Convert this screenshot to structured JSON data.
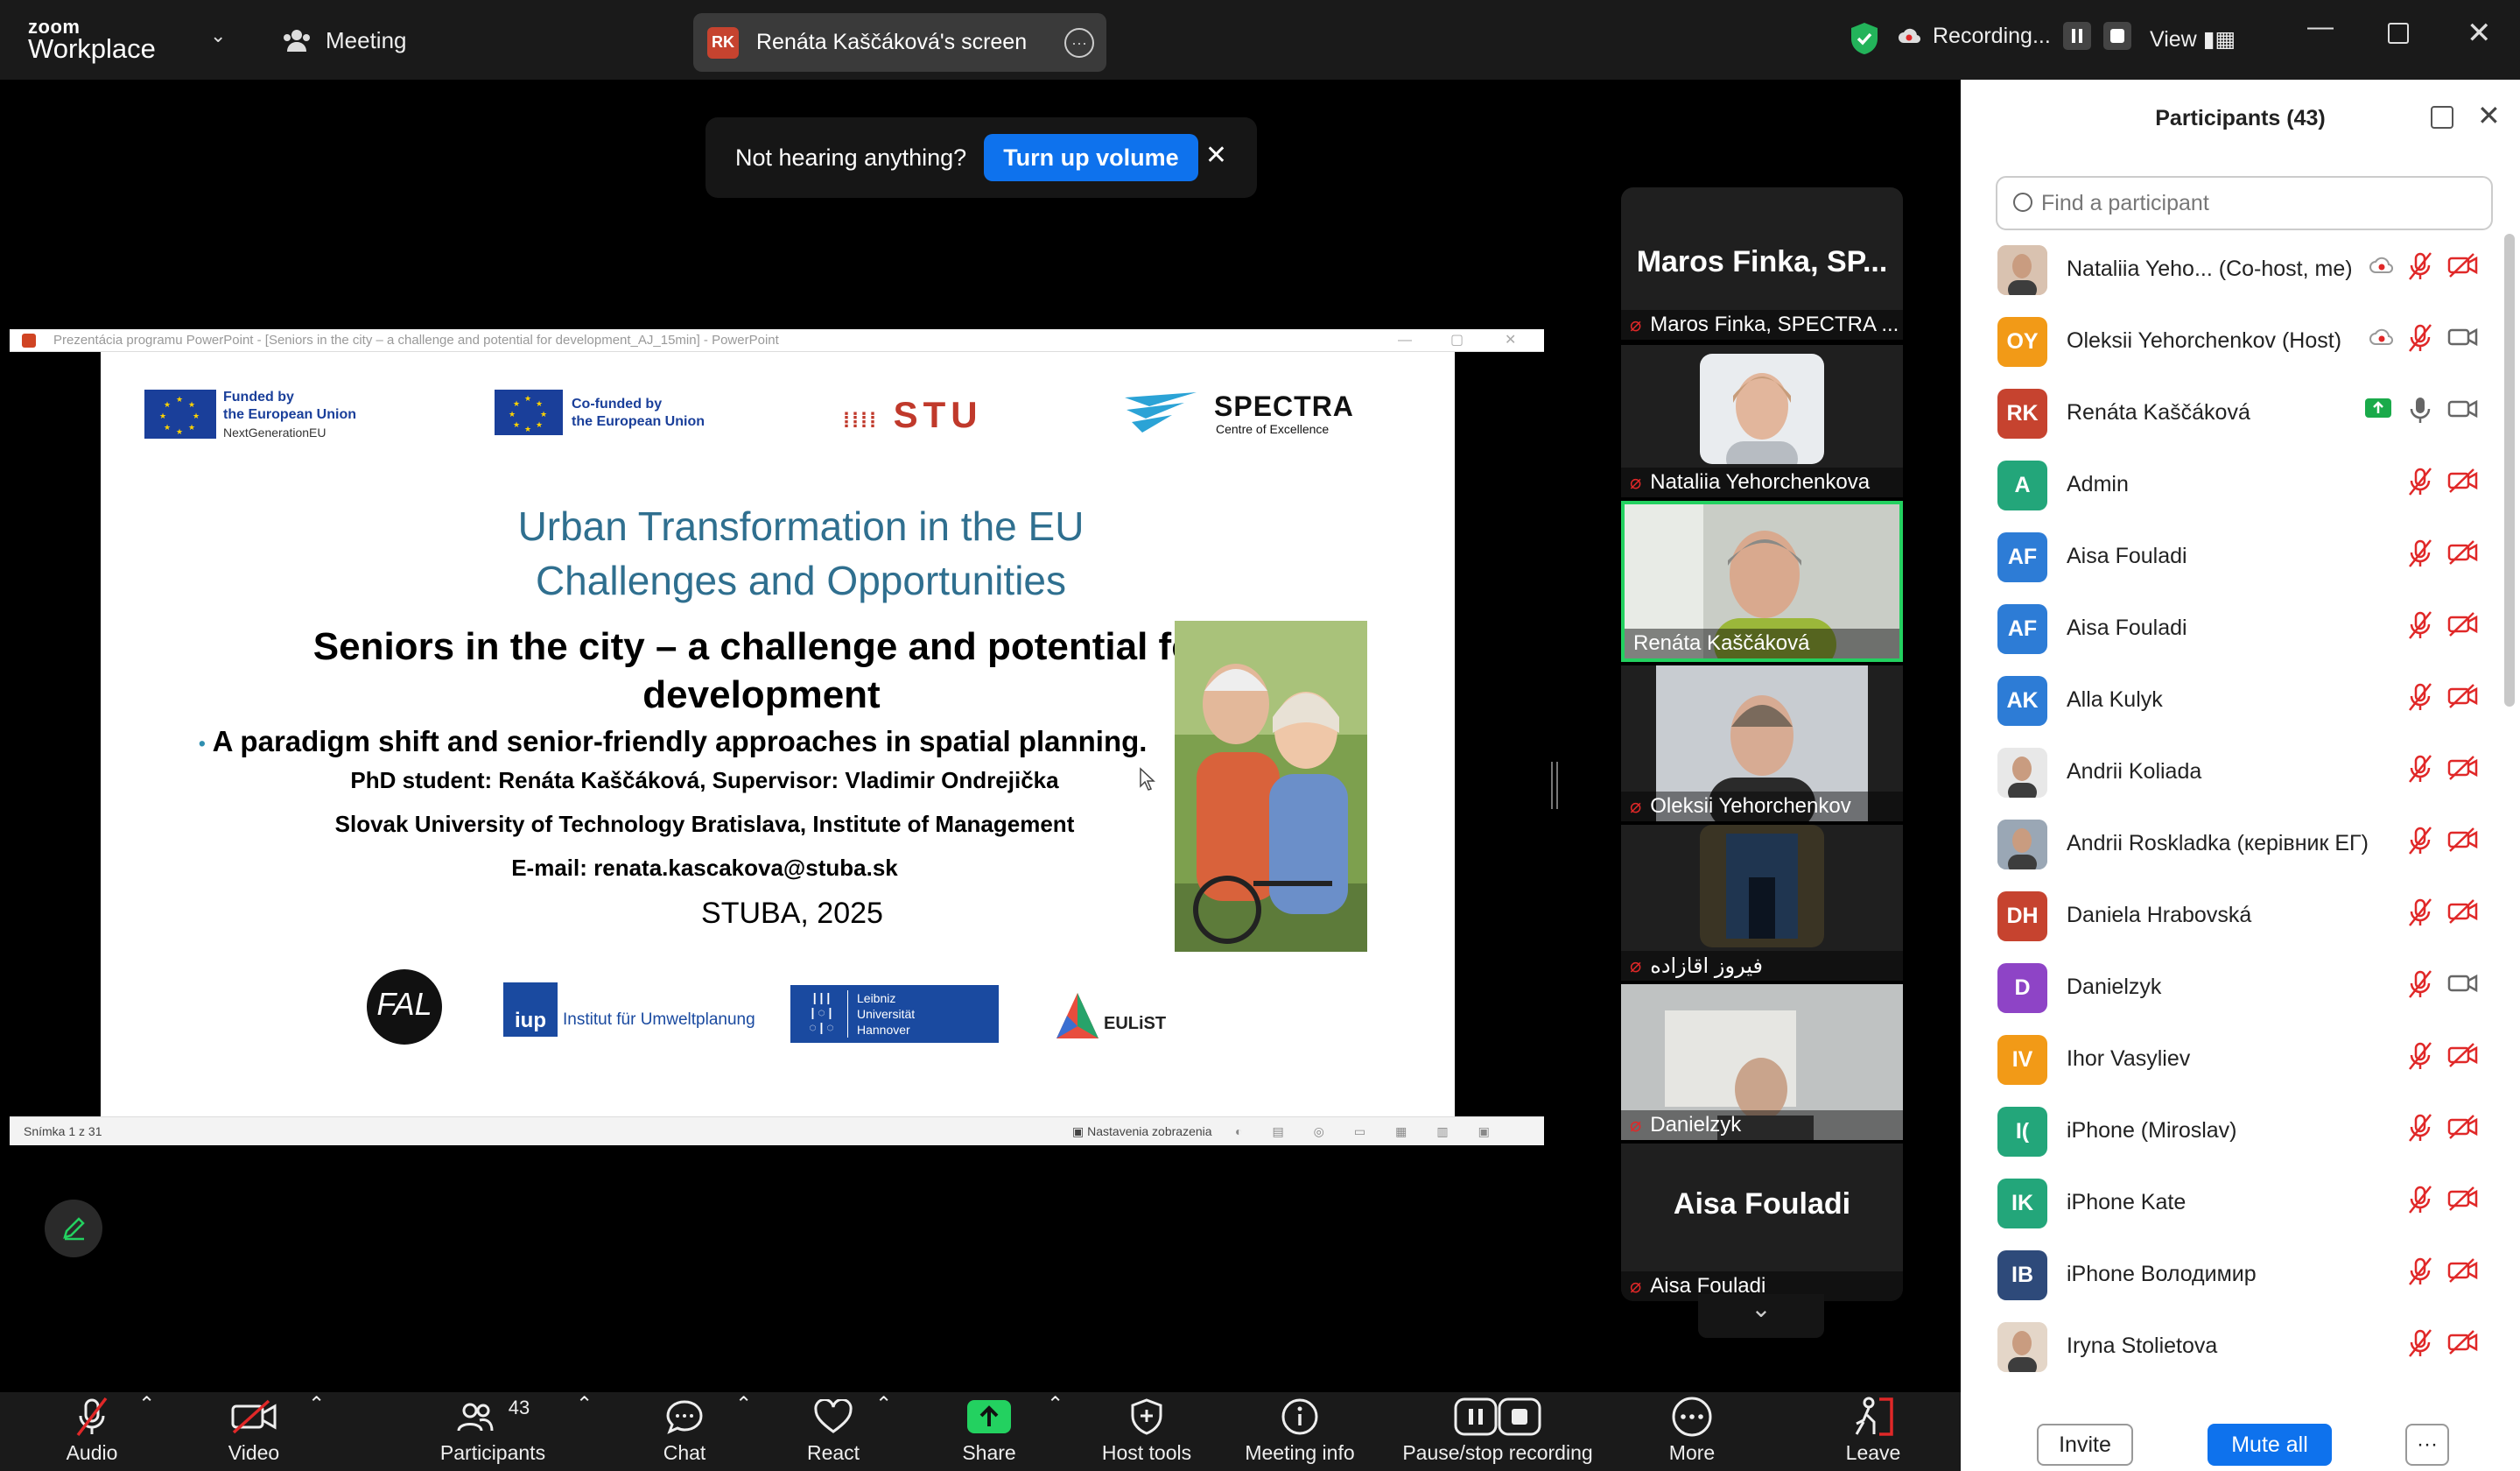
{
  "app": {
    "brand_top": "zoom",
    "brand_bottom": "Workplace",
    "meeting_label": "Meeting"
  },
  "screen_share": {
    "badge": "RK",
    "label": "Renáta Kaščáková's screen"
  },
  "recording": {
    "label": "Recording..."
  },
  "view": {
    "label": "View"
  },
  "notice": {
    "message": "Not hearing anything?",
    "button": "Turn up volume"
  },
  "ppt": {
    "window_title": "Prezentácia programu PowerPoint - [Seniors in the city – a challenge and potential for development_AJ_15min] - PowerPoint",
    "status_left": "Snímka 1 z 31",
    "status_view": "Nastavenia zobrazenia"
  },
  "slide": {
    "logo_eu1_line1": "Funded by",
    "logo_eu1_line2": "the European Union",
    "logo_eu1_line3": "NextGenerationEU",
    "logo_eu2_line1": "Co-funded by",
    "logo_eu2_line2": "the European Union",
    "logo_stu": "STU",
    "logo_spectra": "SPECTRA",
    "logo_spectra_sub": "Centre of Excellence",
    "heading1": "Urban Transformation in the EU",
    "heading2": "Challenges and Opportunities",
    "title_line1": "Seniors in the city – a challenge and potential for",
    "title_line2": "development",
    "subtitle": "A paradigm shift and senior-friendly approaches in spatial planning.",
    "phd_line": "PhD student:  Renáta Kaščáková, Supervisor: Vladimir Ondrejička",
    "university": "Slovak University of Technology Bratislava, Institute of Management",
    "email": "E-mail:  renata.kascakova@stuba.sk",
    "footer": "STUBA, 2025",
    "logo_fal": "FAL",
    "logo_iup": "iup",
    "logo_iup_text": "Institut für Umweltplanung",
    "logo_luh_line1": "Leibniz",
    "logo_luh_line2": "Universität",
    "logo_luh_line3": "Hannover",
    "logo_eulist": "EULiST"
  },
  "gallery": {
    "tiles": [
      {
        "big": "Maros Finka, SP...",
        "name": "Maros Finka, SPECTRA ..."
      },
      {
        "name": "Nataliia Yehorchenkova"
      },
      {
        "name": "Renáta Kaščáková"
      },
      {
        "name": "Oleksii Yehorchenkov"
      },
      {
        "name": "فیروز اقازاده"
      },
      {
        "name": "Danielzyk"
      },
      {
        "big": "Aisa Fouladi",
        "name": "Aisa Fouladi"
      }
    ]
  },
  "toolbar": {
    "audio": "Audio",
    "video": "Video",
    "participants": "Participants",
    "participants_count": "43",
    "chat": "Chat",
    "react": "React",
    "share": "Share",
    "host_tools": "Host tools",
    "meeting_info": "Meeting info",
    "pause_stop": "Pause/stop recording",
    "more": "More",
    "leave": "Leave"
  },
  "panel": {
    "title": "Participants (43)",
    "search_placeholder": "Find a participant",
    "invite": "Invite",
    "mute_all": "Mute all",
    "more": "···",
    "participants": [
      {
        "initials": "",
        "name": "Nataliia Yeho...  (Co-host, me)",
        "color": "#d9c2b0",
        "photo": true
      },
      {
        "initials": "OY",
        "name": "Oleksii Yehorchenkov (Host)",
        "color": "#f29a17"
      },
      {
        "initials": "RK",
        "name": "Renáta Kaščáková",
        "color": "#c6432f"
      },
      {
        "initials": "A",
        "name": "Admin",
        "color": "#23a67a"
      },
      {
        "initials": "AF",
        "name": "Aisa Fouladi",
        "color": "#2d7cd6"
      },
      {
        "initials": "AF",
        "name": "Aisa Fouladi",
        "color": "#2d7cd6"
      },
      {
        "initials": "AK",
        "name": "Alla Kulyk",
        "color": "#2d7cd6"
      },
      {
        "initials": "",
        "name": "Andrii Koliada",
        "color": "#e8e8e8",
        "photo": true
      },
      {
        "initials": "",
        "name": "Andrii Roskladka (керівник ЕГ)",
        "color": "#9aa7b5",
        "photo": true
      },
      {
        "initials": "DH",
        "name": "Daniela Hrabovská",
        "color": "#c6432f"
      },
      {
        "initials": "D",
        "name": "Danielzyk",
        "color": "#8e44c6"
      },
      {
        "initials": "IV",
        "name": "Ihor Vasyliev",
        "color": "#f29a17"
      },
      {
        "initials": "I(",
        "name": "iPhone (Miroslav)",
        "color": "#23a67a"
      },
      {
        "initials": "IK",
        "name": "iPhone Kate",
        "color": "#23a67a"
      },
      {
        "initials": "IB",
        "name": "iPhone Володимир",
        "color": "#2e4a7a"
      },
      {
        "initials": "",
        "name": "Iryna Stolietova",
        "color": "#e4d6c8",
        "photo": true
      }
    ]
  }
}
